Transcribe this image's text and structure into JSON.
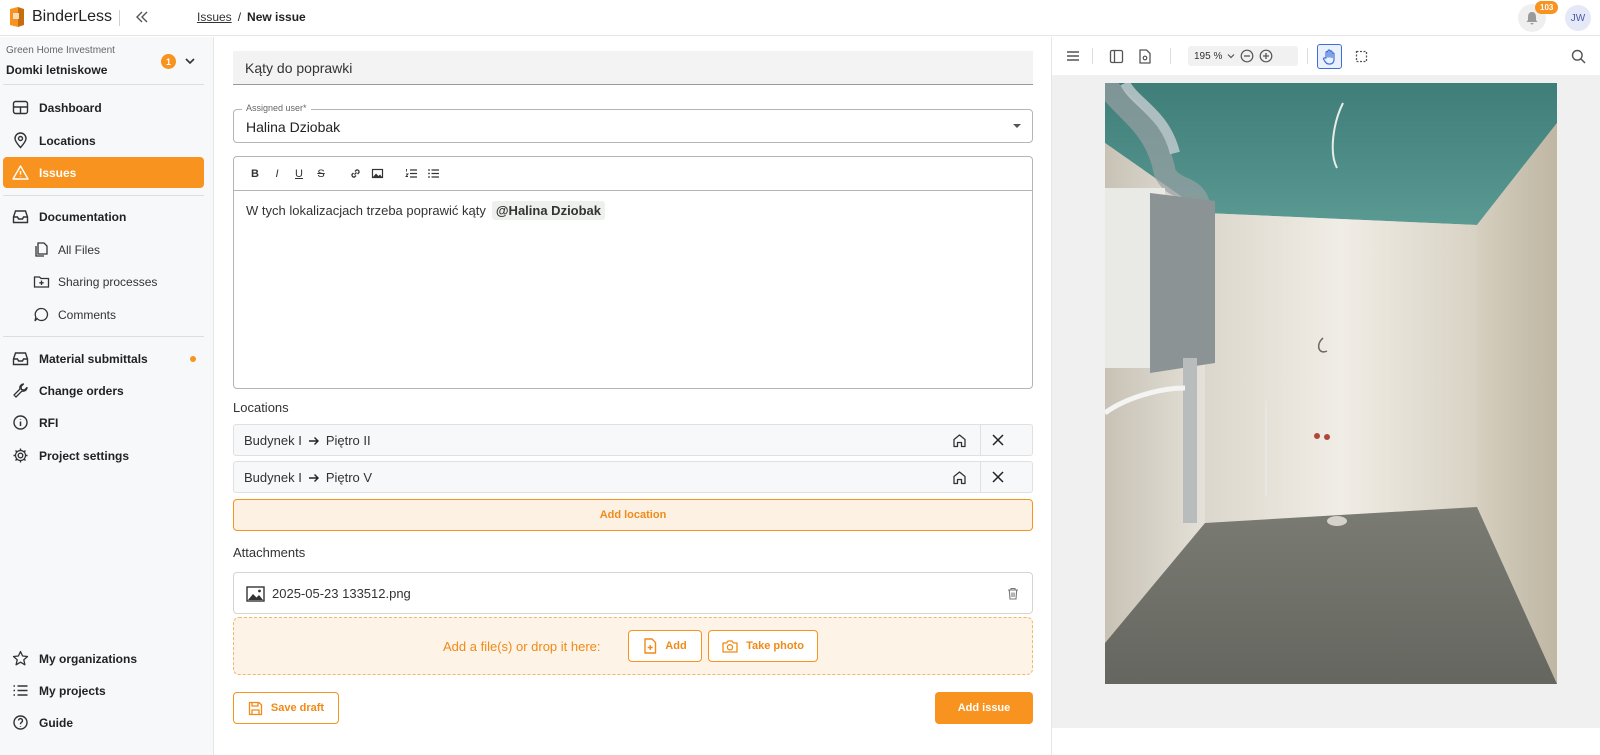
{
  "app": {
    "name": "BinderLess"
  },
  "breadcrumb": {
    "link": "Issues",
    "separator": "/",
    "current": "New issue"
  },
  "header": {
    "notifications_count": "103",
    "user_initials": "JW"
  },
  "sidebar": {
    "organization": "Green Home Investment",
    "project": "Domki letniskowe",
    "project_badge": "1",
    "items": [
      {
        "label": "Dashboard"
      },
      {
        "label": "Locations"
      },
      {
        "label": "Issues"
      },
      {
        "label": "Documentation"
      },
      {
        "label": "All Files"
      },
      {
        "label": "Sharing processes"
      },
      {
        "label": "Comments"
      },
      {
        "label": "Material submittals"
      },
      {
        "label": "Change orders"
      },
      {
        "label": "RFI"
      },
      {
        "label": "Project settings"
      },
      {
        "label": "My organizations"
      },
      {
        "label": "My projects"
      },
      {
        "label": "Guide"
      }
    ]
  },
  "form": {
    "title_value": "Kąty do poprawki",
    "assigned_label": "Assigned user*",
    "assigned_value": "Halina Dziobak",
    "editor_toolbar": [
      "B",
      "I",
      "U",
      "S"
    ],
    "description_text": "W tych lokalizacjach trzeba poprawić kąty",
    "mention": "@Halina Dziobak",
    "locations_label": "Locations",
    "locations": [
      {
        "from": "Budynek I",
        "to": "Piętro II"
      },
      {
        "from": "Budynek I",
        "to": "Piętro V"
      }
    ],
    "add_location_label": "Add location",
    "attachments_label": "Attachments",
    "attachment_name": "2025-05-23 133512.png",
    "drop_text": "Add a file(s) or drop it here:",
    "add_file_label": "Add",
    "take_photo_label": "Take photo",
    "save_draft_label": "Save draft",
    "add_issue_label": "Add issue"
  },
  "viewer": {
    "zoom_level": "195 %"
  },
  "colors": {
    "accent": "#f7931e",
    "accent_light": "#fdf1e4",
    "sidebar_bg": "#f7f8fa"
  }
}
